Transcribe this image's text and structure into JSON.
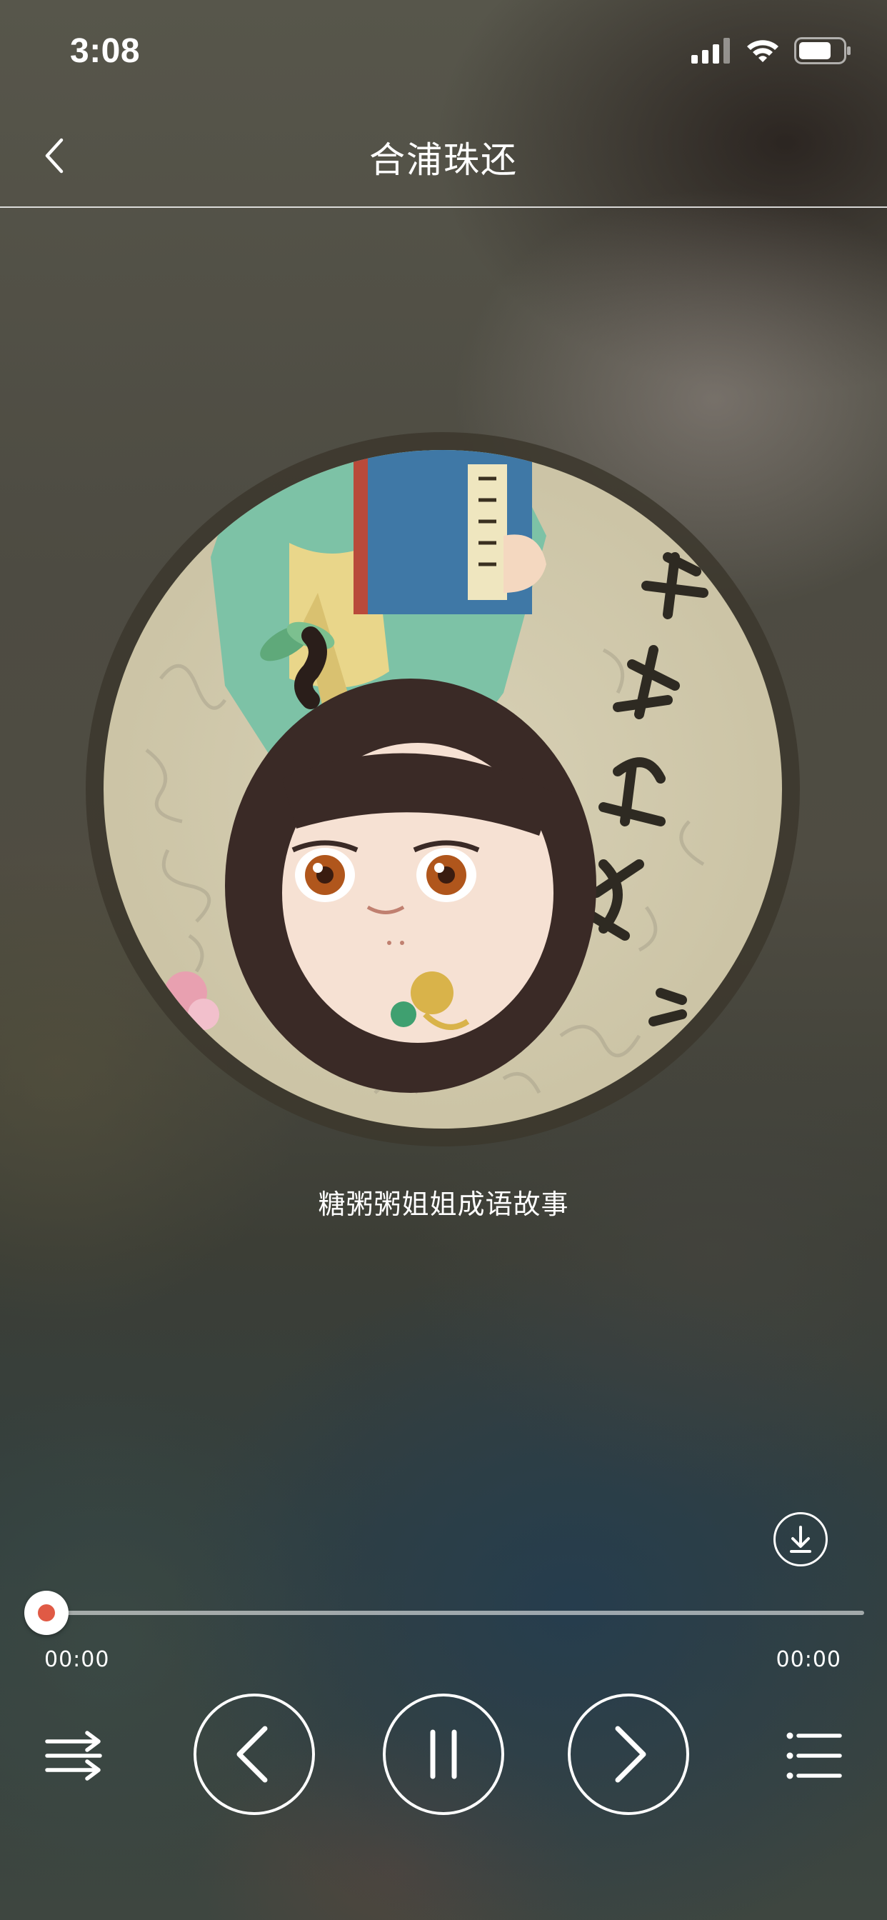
{
  "status_bar": {
    "time": "3:08",
    "icons": [
      "cellular-signal-icon",
      "wifi-icon",
      "battery-icon"
    ]
  },
  "nav": {
    "title": "合浦珠还",
    "back_icon": "chevron-left-icon"
  },
  "album": {
    "cover_icon": "album-cover-illustration",
    "name": "糖粥粥姐姐成语故事"
  },
  "player": {
    "download_icon": "download-icon",
    "progress": 0,
    "current_time": "00:00",
    "total_time": "00:00",
    "accent_color": "#e05a45",
    "controls": {
      "shuffle_icon": "shuffle-icon",
      "prev_icon": "previous-icon",
      "pause_icon": "pause-icon",
      "next_icon": "next-icon",
      "playlist_icon": "playlist-icon"
    }
  }
}
